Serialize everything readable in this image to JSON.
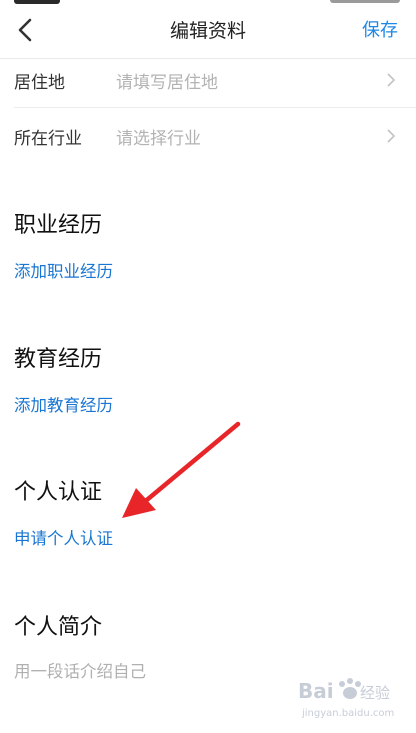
{
  "header": {
    "title": "编辑资料",
    "save_label": "保存"
  },
  "form": {
    "residence": {
      "label": "居住地",
      "placeholder": "请填写居住地"
    },
    "industry": {
      "label": "所在行业",
      "placeholder": "请选择行业"
    }
  },
  "sections": {
    "work": {
      "title": "职业经历",
      "action": "添加职业经历"
    },
    "education": {
      "title": "教育经历",
      "action": "添加教育经历"
    },
    "verification": {
      "title": "个人认证",
      "action": "申请个人认证"
    },
    "intro": {
      "title": "个人简介",
      "placeholder": "用一段话介绍自己"
    }
  },
  "watermark": {
    "brand": "Bai",
    "brand_suffix": "经验",
    "site": "jingyan.baidu.com"
  },
  "colors": {
    "accent": "#1e88e5",
    "link": "#1976d2",
    "annotation_arrow": "#e8262a"
  },
  "icons": {
    "back": "chevron-left-icon",
    "row_arrow": "chevron-right-icon",
    "annotation": "red-arrow-annotation"
  }
}
